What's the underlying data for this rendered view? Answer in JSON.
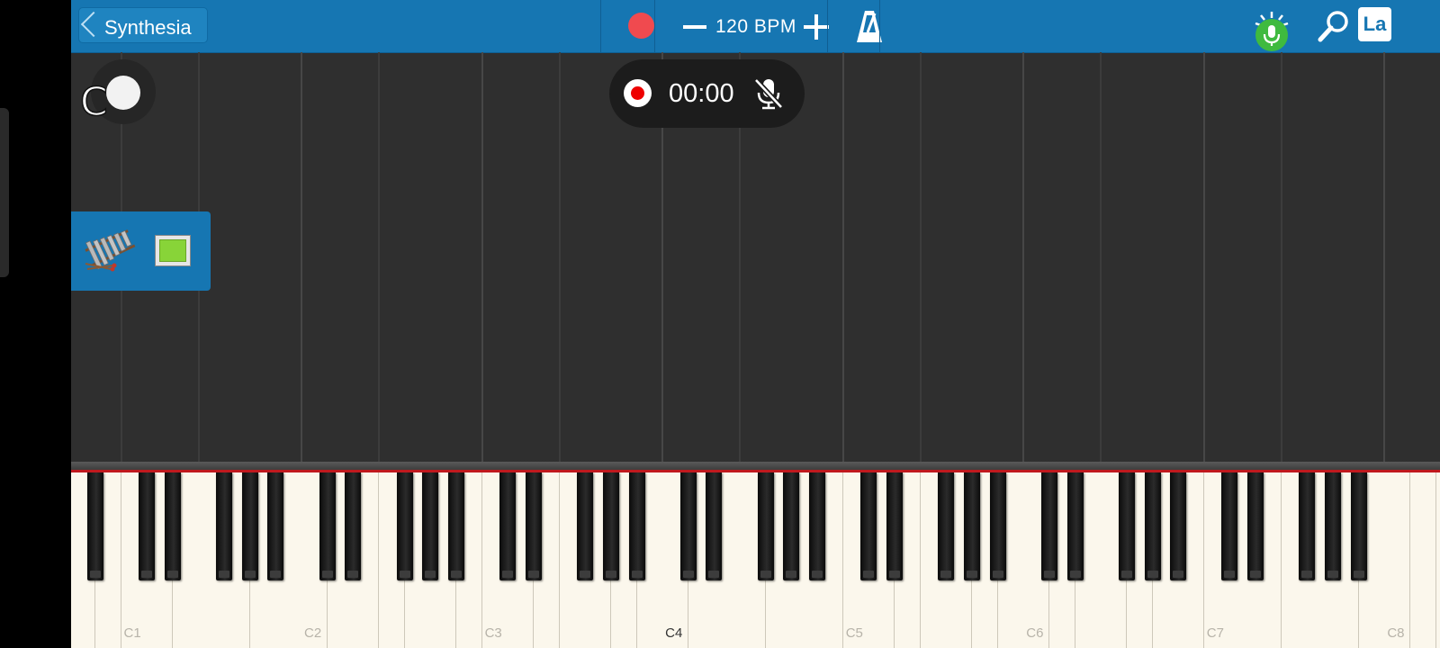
{
  "topbar": {
    "back_label": "Synthesia",
    "bpm_label": "120 BPM",
    "la_label": "La"
  },
  "recorder": {
    "time": "00:00"
  },
  "key_toggle": {
    "letter": "C"
  },
  "keyboard": {
    "octave_labels": [
      "C1",
      "C2",
      "C3",
      "C4",
      "C5",
      "C6",
      "C7",
      "C8"
    ]
  },
  "colors": {
    "topbar": "#1676b2",
    "record": "#f04a4f",
    "swatch": "#88d438",
    "mic_green": "#3fba3f"
  }
}
